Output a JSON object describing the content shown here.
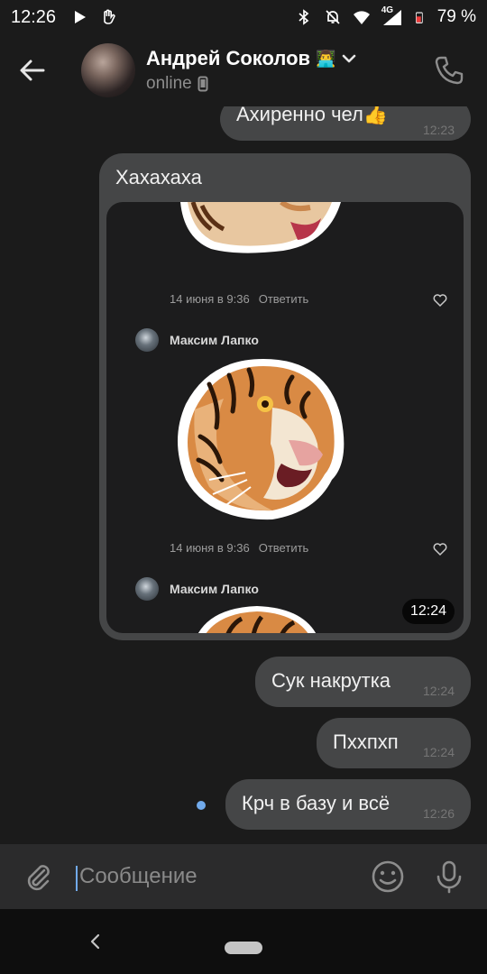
{
  "status_bar": {
    "time": "12:26",
    "network": "4G",
    "battery": "79 %"
  },
  "header": {
    "title": "Андрей Соколов",
    "title_emoji": "👨‍💻",
    "status": "online",
    "icons": [
      "back-arrow-icon",
      "chevron-down-icon",
      "phone-icon",
      "mobile-device-icon"
    ]
  },
  "messages": [
    {
      "text": "Ахиренно чел👍",
      "time": "12:23"
    },
    {
      "text": "Хахахаха",
      "time": "12:24",
      "attachment": {
        "posts": [
          {
            "date": "14 июня в 9:36",
            "reply": "Ответить"
          },
          {
            "author": "Максим Лапко"
          },
          {
            "date": "14 июня в 9:36",
            "reply": "Ответить"
          },
          {
            "author": "Максим Лапко"
          }
        ]
      }
    },
    {
      "text": "Сук накрутка",
      "time": "12:24"
    },
    {
      "text": "Пххпхп",
      "time": "12:24"
    },
    {
      "text": "Крч в базу и всё",
      "time": "12:26"
    }
  ],
  "composer": {
    "placeholder": "Сообщение"
  },
  "colors": {
    "background": "#1b1b1b",
    "bubble": "#454647",
    "accent": "#71aaeb"
  }
}
